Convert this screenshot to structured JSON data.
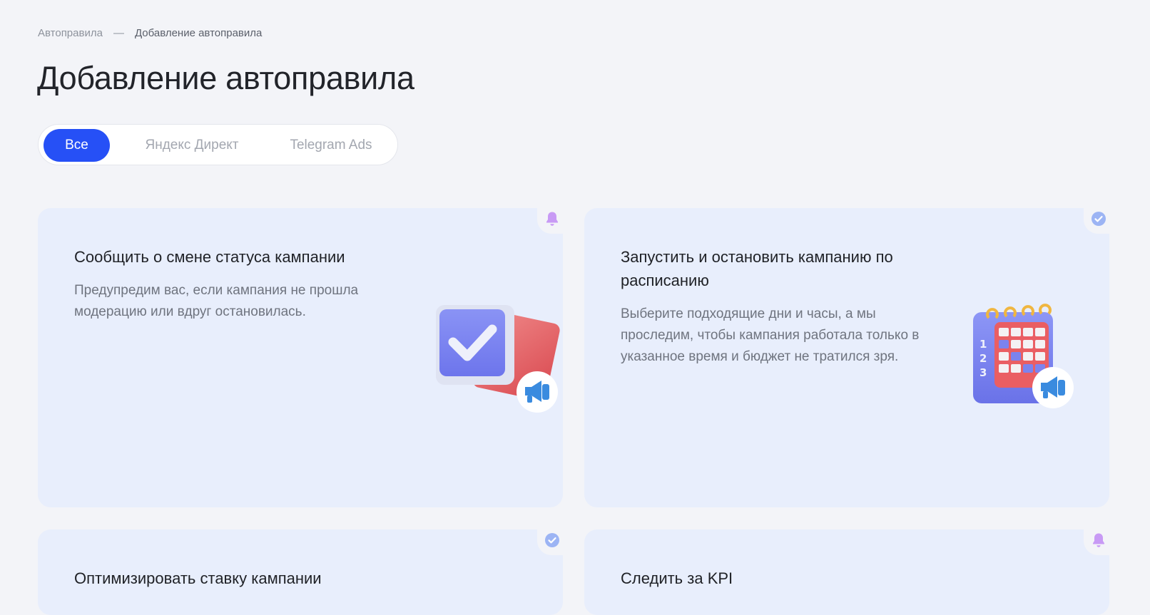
{
  "breadcrumb": {
    "parent": "Автоправила",
    "separator": "—",
    "current": "Добавление автоправила"
  },
  "page_title": "Добавление автоправила",
  "tabs": [
    {
      "label": "Все",
      "active": true
    },
    {
      "label": "Яндекс Директ",
      "active": false
    },
    {
      "label": "Telegram Ads",
      "active": false
    }
  ],
  "cards": [
    {
      "title": "Сообщить о смене статуса кампании",
      "description": "Предупредим вас, если кампания не прошла модерацию или вдруг остановилась.",
      "corner_icon": "bell-icon",
      "illustration": "checkbox-card-illustration"
    },
    {
      "title": "Запустить и остановить кампанию по расписанию",
      "description": "Выберите подходящие дни и часы, а мы проследим, чтобы кампания работала только в указанное время и бюджет не тратился зря.",
      "corner_icon": "check-circle-icon",
      "illustration": "calendar-illustration"
    },
    {
      "title": "Оптимизировать ставку кампании",
      "description": "",
      "corner_icon": "check-circle-icon"
    },
    {
      "title": "Следить за KPI",
      "description": "",
      "corner_icon": "bell-icon"
    }
  ],
  "colors": {
    "background": "#f3f4f8",
    "accent": "#2650f6",
    "card": "#e8eefc",
    "bell": "#c89af5",
    "check": "#9cb4f4"
  }
}
